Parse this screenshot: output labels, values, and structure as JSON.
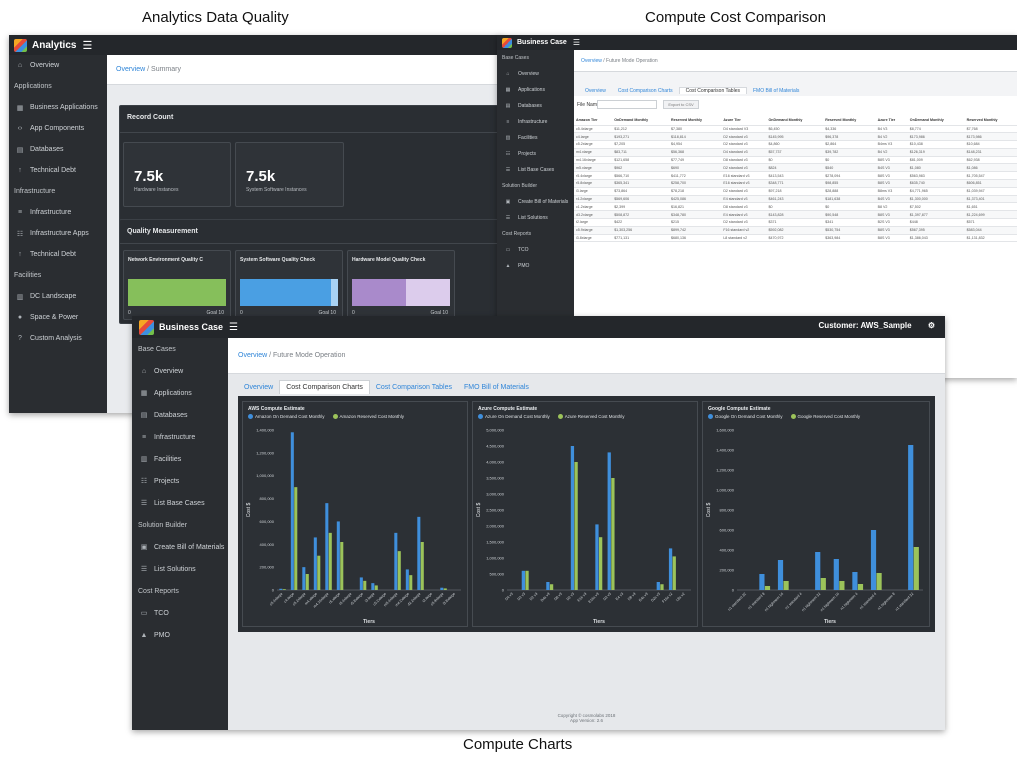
{
  "captions": {
    "top_left": "Analytics Data Quality",
    "top_right": "Compute Cost Comparison",
    "bottom": "Compute Charts"
  },
  "colors": {
    "topbar": "#24272b",
    "sidebar": "#2a2d31",
    "link": "#2f85d8",
    "aws_on_demand": "#3f8fdc",
    "aws_reserved": "#9cc35a",
    "quality_green": "#86bf5b",
    "quality_blue": "#4a9fe3",
    "quality_purple": "#a98acb"
  },
  "w1": {
    "brand": "Analytics",
    "menu_icon": "hamburger-icon",
    "sidebar": [
      {
        "icon": "home-icon",
        "label": "Overview",
        "head": false
      },
      {
        "icon": "",
        "label": "Applications",
        "head": true
      },
      {
        "icon": "grid-icon",
        "label": "Business Applications",
        "head": false
      },
      {
        "icon": "code-icon",
        "label": "App Components",
        "head": false
      },
      {
        "icon": "database-icon",
        "label": "Databases",
        "head": false
      },
      {
        "icon": "debt-icon",
        "label": "Technical Debt",
        "head": false
      },
      {
        "icon": "",
        "label": "Infrastructure",
        "head": true
      },
      {
        "icon": "server-icon",
        "label": "Infrastructure",
        "head": false
      },
      {
        "icon": "sitemap-icon",
        "label": "Infrastructure Apps",
        "head": false
      },
      {
        "icon": "debt-icon",
        "label": "Technical Debt",
        "head": false
      },
      {
        "icon": "",
        "label": "Facilities",
        "head": true
      },
      {
        "icon": "building-icon",
        "label": "DC Landscape",
        "head": false
      },
      {
        "icon": "power-icon",
        "label": "Space & Power",
        "head": false
      },
      {
        "icon": "question-icon",
        "label": "Custom Analysis",
        "head": false
      }
    ],
    "breadcrumb": {
      "link": "Overview",
      "sep": " / ",
      "current": "Summary"
    },
    "record_count": {
      "title": "Record Count",
      "cards": [
        {
          "value": "7.5k",
          "label": "Hardware Instances"
        },
        {
          "value": "7.5k",
          "label": "System Software Instances"
        }
      ]
    },
    "quality": {
      "title": "Quality Measurement",
      "cards": [
        {
          "title": "Network Environment Quality C",
          "min": "0",
          "goal": "Goal 10",
          "fill": 1.0,
          "color": "#86bf5b",
          "rest": "#86bf5b"
        },
        {
          "title": "System Software Quality Check",
          "min": "0",
          "goal": "Goal 10",
          "fill": 0.93,
          "color": "#4a9fe3",
          "rest": "#a9d2f3"
        },
        {
          "title": "Hardware Model Quality Check",
          "min": "0",
          "goal": "Goal 10",
          "fill": 0.55,
          "color": "#a98acb",
          "rest": "#dcccec"
        }
      ]
    }
  },
  "w2": {
    "brand": "Business Case",
    "menu_icon": "hamburger-icon",
    "sidebar": [
      {
        "icon": "",
        "label": "Base Cases",
        "head": true
      },
      {
        "icon": "home-icon",
        "label": "Overview",
        "head": false
      },
      {
        "icon": "grid-icon",
        "label": "Applications",
        "head": false
      },
      {
        "icon": "database-icon",
        "label": "Databases",
        "head": false
      },
      {
        "icon": "server-icon",
        "label": "Infrastructure",
        "head": false
      },
      {
        "icon": "building-icon",
        "label": "Facilities",
        "head": false
      },
      {
        "icon": "sitemap-icon",
        "label": "Projects",
        "head": false
      },
      {
        "icon": "list-icon",
        "label": "List Base Cases",
        "head": false
      },
      {
        "icon": "",
        "label": "Solution Builder",
        "head": true
      },
      {
        "icon": "bom-icon",
        "label": "Create Bill of Materials",
        "head": false
      },
      {
        "icon": "list-icon",
        "label": "List Solutions",
        "head": false
      },
      {
        "icon": "",
        "label": "Cost Reports",
        "head": true
      },
      {
        "icon": "tco-icon",
        "label": "TCO",
        "head": false
      },
      {
        "icon": "pmo-icon",
        "label": "PMO",
        "head": false
      }
    ],
    "breadcrumb": {
      "link": "Overview",
      "sep": " / ",
      "current": "Future Mode Operation"
    },
    "tabs": [
      "Overview",
      "Cost Comparison Charts",
      "Cost Comparison Tables",
      "FMO Bill of Materials"
    ],
    "active_tab": 2,
    "file_name_label": "File Name:",
    "export_button": "Export to CSV",
    "table": {
      "headers": [
        "Amazon Tier",
        "OnDemand Monthly",
        "Reserved Monthly",
        "Azure Tier",
        "OnDemand Monthly",
        "Reserved Monthly",
        "Azure Tier",
        "OnDemand Monthly",
        "Reserved Monthly"
      ],
      "rows": [
        [
          "c5.4xlarge",
          "$11,212",
          "$7,380",
          "D4 standard V3",
          "$6,450",
          "$4,336",
          "B4 V3",
          "$8,774",
          "$7,768"
        ],
        [
          "c4.large",
          "$193,271",
          "$118,814",
          "D2 standard v3",
          "$145,995",
          "$96,378",
          "B4 V2",
          "$173,986",
          "$173,986"
        ],
        [
          "c5.2xlarge",
          "$7,205",
          "$4,954",
          "D2 standard v3",
          "$4,860",
          "$2,864",
          "B4ms V3",
          "$10,438",
          "$10,684"
        ],
        [
          "m4.xlarge",
          "$83,711",
          "$56,368",
          "D4 standard v3",
          "$57,737",
          "$39,782",
          "B4 V2",
          "$126,319",
          "$148,231"
        ],
        [
          "m4.16xlarge",
          "$121,658",
          "$77,749",
          "D8 standard v3",
          "$0",
          "$0",
          "B8S V3",
          "$81,009",
          "$62,938"
        ],
        [
          "m5.xlarge",
          "$962",
          "$690",
          "D2 standard v3",
          "$824",
          "$540",
          "B4S V3",
          "$1,080",
          "$1,086"
        ],
        [
          "r5.4xlarge",
          "$566,710",
          "$411,772",
          "E16 standard v3",
          "$413,543",
          "$278,094",
          "B8S V3",
          "$563,983",
          "$1,705,547"
        ],
        [
          "r5.8xlarge",
          "$365,341",
          "$258,700",
          "E16 standard v3",
          "$348,771",
          "$98,855",
          "B8S V3",
          "$635,740",
          "$606,851"
        ],
        [
          "i3.large",
          "$73,864",
          "$78,218",
          "D2 standard v3",
          "$97,218",
          "$28,888",
          "B8ms V3",
          "$4,771,965",
          "$1,039,947"
        ],
        [
          "r4.2xlarge",
          "$569,606",
          "$425,086",
          "E4 standard v3",
          "$461,243",
          "$181,638",
          "B4S V3",
          "$1,300,000",
          "$1,373,401"
        ],
        [
          "c1.2xlarge",
          "$2,399",
          "$16,821",
          "D8 standard v3",
          "$0",
          "$0",
          "B8 V2",
          "$7,502",
          "$1,651"
        ],
        [
          "d3.2xlarge",
          "$508,872",
          "$348,780",
          "E4 standard v3",
          "$143,828",
          "$90,548",
          "B8S V3",
          "$1,397,877",
          "$1,224,699"
        ],
        [
          "t2.large",
          "$422",
          "$215",
          "D2 standard v3",
          "$371",
          "$341",
          "B2S V3",
          "$448",
          "$571"
        ],
        [
          "c5.9xlarge",
          "$1,303,256",
          "$899,742",
          "F16 standard v2",
          "$592,082",
          "$530,754",
          "B8S V3",
          "$567,395",
          "$583,044"
        ],
        [
          "i3.8xlarge",
          "$771,131",
          "$680,136",
          "L8 standard v2",
          "$470,972",
          "$363,984",
          "B8S V3",
          "$1,386,043",
          "$1,131,832"
        ]
      ]
    }
  },
  "w3": {
    "brand": "Business Case",
    "menu_icon": "hamburger-icon",
    "customer": "Customer: AWS_Sample",
    "settings_icon": "gear-icon",
    "sidebar": [
      {
        "icon": "",
        "label": "Base Cases",
        "head": true
      },
      {
        "icon": "home-icon",
        "label": "Overview",
        "head": false
      },
      {
        "icon": "grid-icon",
        "label": "Applications",
        "head": false
      },
      {
        "icon": "database-icon",
        "label": "Databases",
        "head": false
      },
      {
        "icon": "server-icon",
        "label": "Infrastructure",
        "head": false
      },
      {
        "icon": "building-icon",
        "label": "Facilities",
        "head": false
      },
      {
        "icon": "sitemap-icon",
        "label": "Projects",
        "head": false
      },
      {
        "icon": "list-icon",
        "label": "List Base Cases",
        "head": false
      },
      {
        "icon": "",
        "label": "Solution Builder",
        "head": true
      },
      {
        "icon": "bom-icon",
        "label": "Create Bill of Materials",
        "head": false
      },
      {
        "icon": "list-icon",
        "label": "List Solutions",
        "head": false
      },
      {
        "icon": "",
        "label": "Cost Reports",
        "head": true
      },
      {
        "icon": "tco-icon",
        "label": "TCO",
        "head": false
      },
      {
        "icon": "pmo-icon",
        "label": "PMO",
        "head": false
      }
    ],
    "breadcrumb": {
      "link": "Overview",
      "sep": " / ",
      "current": "Future Mode Operation"
    },
    "tabs": [
      "Overview",
      "Cost Comparison Charts",
      "Cost Comparison Tables",
      "FMO Bill of Materials"
    ],
    "active_tab": 1,
    "footer": {
      "line1": "Copyright © cosmolabs 2018",
      "line2": "App Version: 2.6"
    }
  },
  "chart_data": [
    {
      "type": "bar",
      "title": "AWS Compute Estimate",
      "ylabel": "Cost $",
      "xlabel": "Tiers",
      "ylim": [
        0,
        1400000
      ],
      "yticks": [
        0,
        200000,
        400000,
        600000,
        800000,
        1000000,
        1200000,
        1400000
      ],
      "ytick_labels": [
        "0",
        "200,000",
        "400,000",
        "600,000",
        "800,000",
        "1,000,000",
        "1,200,000",
        "1,400,000"
      ],
      "categories": [
        "c5.4xlarge",
        "c4.large",
        "c5.2xlarge",
        "m4.xlarge",
        "m4.16xlarge",
        "r5.xlarge",
        "r5.4xlarge",
        "r5.8xlarge",
        "i3.large",
        "c5.2xlarge",
        "m5.4xlarge",
        "m4.2xlarge",
        "d2.2xlarge",
        "t2.large",
        "c5.9xlarge",
        "i3.8xlarge"
      ],
      "series": [
        {
          "name": "Amazon On Demand Cost Monthly",
          "color": "#3f8fdc",
          "values": [
            11000,
            1380000,
            200000,
            460000,
            760000,
            600000,
            0,
            110000,
            60000,
            0,
            500000,
            180000,
            640000,
            0,
            20000,
            0
          ]
        },
        {
          "name": "Amazon Reserved Cost Monthly",
          "color": "#9cc35a",
          "values": [
            7000,
            900000,
            140000,
            300000,
            500000,
            420000,
            0,
            80000,
            40000,
            0,
            340000,
            130000,
            420000,
            0,
            14000,
            0
          ]
        }
      ]
    },
    {
      "type": "bar",
      "title": "Azure Compute Estimate",
      "ylabel": "Cost $",
      "xlabel": "Tiers",
      "ylim": [
        0,
        5000000
      ],
      "yticks": [
        0,
        500000,
        1000000,
        1500000,
        2000000,
        2500000,
        3000000,
        3500000,
        4000000,
        4500000,
        5000000
      ],
      "ytick_labels": [
        "0",
        "500,000",
        "1,000,000",
        "1,500,000",
        "2,000,000",
        "2,500,000",
        "3,000,000",
        "3,500,000",
        "4,000,000",
        "4,500,000",
        "5,000,000"
      ],
      "categories": [
        "D4 v3",
        "D2 v3",
        "D2 v3",
        "D4s v3",
        "D8 v3",
        "D2 v3",
        "E16 v3",
        "E16s v3",
        "D2 v3",
        "E4 v3",
        "D8 v3",
        "E4s v3",
        "D2s v3",
        "F16s v2",
        "L8s v2"
      ],
      "series": [
        {
          "name": "Azure On Demand Cost Monthly",
          "color": "#3f8fdc",
          "values": [
            0,
            600000,
            0,
            250000,
            0,
            4500000,
            0,
            2050000,
            4300000,
            0,
            0,
            0,
            250000,
            1300000,
            0
          ]
        },
        {
          "name": "Azure Reserved Cost Monthly",
          "color": "#9cc35a",
          "values": [
            0,
            600000,
            0,
            180000,
            0,
            4000000,
            0,
            1650000,
            3500000,
            0,
            0,
            0,
            180000,
            1050000,
            0
          ]
        }
      ]
    },
    {
      "type": "bar",
      "title": "Google Compute Estimate",
      "ylabel": "Cost $",
      "xlabel": "Tiers",
      "ylim": [
        0,
        1600000
      ],
      "yticks": [
        0,
        200000,
        400000,
        600000,
        800000,
        1000000,
        1200000,
        1400000,
        1600000
      ],
      "ytick_labels": [
        "0",
        "200,000",
        "400,000",
        "600,000",
        "800,000",
        "1,000,000",
        "1,200,000",
        "1,400,000",
        "1,600,000"
      ],
      "categories": [
        "n1 standard 32",
        "n1 standard 8",
        "n1 highmem 16",
        "n1 standard 4",
        "n1 highmem 32",
        "n1 highmem 16",
        "n1 highmem 4",
        "n1 standard 4",
        "n1 highmem 8",
        "n1 standard 32"
      ],
      "series": [
        {
          "name": "Google On Demand Cost Monthly",
          "color": "#3f8fdc",
          "values": [
            0,
            160000,
            300000,
            0,
            380000,
            310000,
            180000,
            600000,
            0,
            1450000
          ]
        },
        {
          "name": "Google Reserved Cost Monthly",
          "color": "#9cc35a",
          "values": [
            0,
            40000,
            90000,
            0,
            120000,
            90000,
            60000,
            170000,
            0,
            430000
          ]
        }
      ]
    }
  ]
}
